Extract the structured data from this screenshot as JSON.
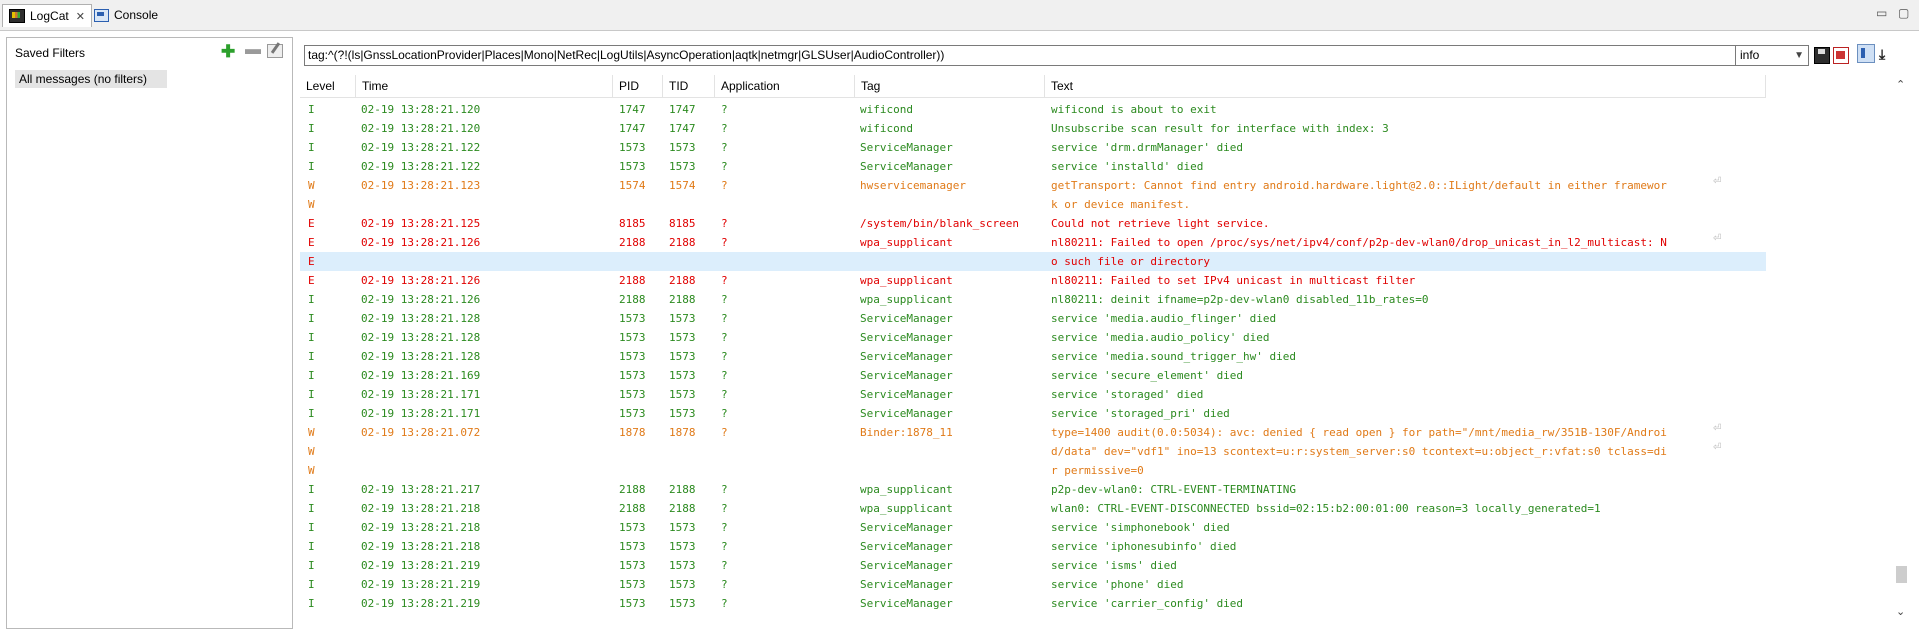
{
  "tabs": [
    {
      "label": "LogCat",
      "icon": "logcat-icon",
      "close": "✕"
    },
    {
      "label": "Console",
      "icon": "console-icon"
    }
  ],
  "window_controls": {
    "minimize": "▭",
    "maximize": "▢"
  },
  "saved_filters": {
    "title": "Saved Filters",
    "add": "✚",
    "remove": "▬",
    "items": [
      "All messages (no filters)"
    ]
  },
  "filter": {
    "query": "tag:^(?!(ls|GnssLocationProvider|Places|Mono|NetRec|LogUtils|AsyncOperation|aqtk|netmgr|GLSUser|AudioController))",
    "level": "info",
    "level_chevron": "▼",
    "download": "⤓"
  },
  "columns": [
    "Level",
    "Time",
    "PID",
    "TID",
    "Application",
    "Tag",
    "Text"
  ],
  "colors": {
    "info": "#2b8a1f",
    "warn": "#e07a18",
    "error": "#e00000",
    "selected_row": "#dceefc"
  },
  "rows": [
    {
      "level": "I",
      "time": "02-19 13:28:21.120",
      "pid": "1747",
      "tid": "1747",
      "app": "?",
      "tag": "wificond",
      "text": "wificond is about to exit"
    },
    {
      "level": "I",
      "time": "02-19 13:28:21.120",
      "pid": "1747",
      "tid": "1747",
      "app": "?",
      "tag": "wificond",
      "text": "Unsubscribe scan result for interface with index: 3"
    },
    {
      "level": "I",
      "time": "02-19 13:28:21.122",
      "pid": "1573",
      "tid": "1573",
      "app": "?",
      "tag": "ServiceManager",
      "text": "service 'drm.drmManager' died"
    },
    {
      "level": "I",
      "time": "02-19 13:28:21.122",
      "pid": "1573",
      "tid": "1573",
      "app": "?",
      "tag": "ServiceManager",
      "text": "service 'installd' died"
    },
    {
      "level": "W",
      "time": "02-19 13:28:21.123",
      "pid": "1574",
      "tid": "1574",
      "app": "?",
      "tag": "hwservicemanager",
      "text": "getTransport: Cannot find entry android.hardware.light@2.0::ILight/default in either framewor",
      "wrap": "⏎"
    },
    {
      "level": "W",
      "time": "",
      "pid": "",
      "tid": "",
      "app": "",
      "tag": "",
      "text": "k or device manifest."
    },
    {
      "level": "E",
      "time": "02-19 13:28:21.125",
      "pid": "8185",
      "tid": "8185",
      "app": "?",
      "tag": "/system/bin/blank_screen",
      "text": "Could not retrieve light service."
    },
    {
      "level": "E",
      "time": "02-19 13:28:21.126",
      "pid": "2188",
      "tid": "2188",
      "app": "?",
      "tag": "wpa_supplicant",
      "text": "nl80211: Failed to open /proc/sys/net/ipv4/conf/p2p-dev-wlan0/drop_unicast_in_l2_multicast: N",
      "wrap": "⏎"
    },
    {
      "level": "E",
      "time": "",
      "pid": "",
      "tid": "",
      "app": "",
      "tag": "",
      "text": "o such file or directory",
      "selected": true
    },
    {
      "level": "E",
      "time": "02-19 13:28:21.126",
      "pid": "2188",
      "tid": "2188",
      "app": "?",
      "tag": "wpa_supplicant",
      "text": "nl80211: Failed to set IPv4 unicast in multicast filter"
    },
    {
      "level": "I",
      "time": "02-19 13:28:21.126",
      "pid": "2188",
      "tid": "2188",
      "app": "?",
      "tag": "wpa_supplicant",
      "text": "nl80211: deinit ifname=p2p-dev-wlan0 disabled_11b_rates=0"
    },
    {
      "level": "I",
      "time": "02-19 13:28:21.128",
      "pid": "1573",
      "tid": "1573",
      "app": "?",
      "tag": "ServiceManager",
      "text": "service 'media.audio_flinger' died"
    },
    {
      "level": "I",
      "time": "02-19 13:28:21.128",
      "pid": "1573",
      "tid": "1573",
      "app": "?",
      "tag": "ServiceManager",
      "text": "service 'media.audio_policy' died"
    },
    {
      "level": "I",
      "time": "02-19 13:28:21.128",
      "pid": "1573",
      "tid": "1573",
      "app": "?",
      "tag": "ServiceManager",
      "text": "service 'media.sound_trigger_hw' died"
    },
    {
      "level": "I",
      "time": "02-19 13:28:21.169",
      "pid": "1573",
      "tid": "1573",
      "app": "?",
      "tag": "ServiceManager",
      "text": "service 'secure_element' died"
    },
    {
      "level": "I",
      "time": "02-19 13:28:21.171",
      "pid": "1573",
      "tid": "1573",
      "app": "?",
      "tag": "ServiceManager",
      "text": "service 'storaged' died"
    },
    {
      "level": "I",
      "time": "02-19 13:28:21.171",
      "pid": "1573",
      "tid": "1573",
      "app": "?",
      "tag": "ServiceManager",
      "text": "service 'storaged_pri' died"
    },
    {
      "level": "W",
      "time": "02-19 13:28:21.072",
      "pid": "1878",
      "tid": "1878",
      "app": "?",
      "tag": "Binder:1878_11",
      "text": "type=1400 audit(0.0:5034): avc: denied { read open } for path=\"/mnt/media_rw/351B-130F/Androi",
      "wrap": "⏎"
    },
    {
      "level": "W",
      "time": "",
      "pid": "",
      "tid": "",
      "app": "",
      "tag": "",
      "text": "d/data\" dev=\"vdf1\" ino=13 scontext=u:r:system_server:s0 tcontext=u:object_r:vfat:s0 tclass=di",
      "wrap": "⏎"
    },
    {
      "level": "W",
      "time": "",
      "pid": "",
      "tid": "",
      "app": "",
      "tag": "",
      "text": "r permissive=0"
    },
    {
      "level": "I",
      "time": "02-19 13:28:21.217",
      "pid": "2188",
      "tid": "2188",
      "app": "?",
      "tag": "wpa_supplicant",
      "text": "p2p-dev-wlan0: CTRL-EVENT-TERMINATING"
    },
    {
      "level": "I",
      "time": "02-19 13:28:21.218",
      "pid": "2188",
      "tid": "2188",
      "app": "?",
      "tag": "wpa_supplicant",
      "text": "wlan0: CTRL-EVENT-DISCONNECTED bssid=02:15:b2:00:01:00 reason=3 locally_generated=1"
    },
    {
      "level": "I",
      "time": "02-19 13:28:21.218",
      "pid": "1573",
      "tid": "1573",
      "app": "?",
      "tag": "ServiceManager",
      "text": "service 'simphonebook' died"
    },
    {
      "level": "I",
      "time": "02-19 13:28:21.218",
      "pid": "1573",
      "tid": "1573",
      "app": "?",
      "tag": "ServiceManager",
      "text": "service 'iphonesubinfo' died"
    },
    {
      "level": "I",
      "time": "02-19 13:28:21.219",
      "pid": "1573",
      "tid": "1573",
      "app": "?",
      "tag": "ServiceManager",
      "text": "service 'isms' died"
    },
    {
      "level": "I",
      "time": "02-19 13:28:21.219",
      "pid": "1573",
      "tid": "1573",
      "app": "?",
      "tag": "ServiceManager",
      "text": "service 'phone' died"
    },
    {
      "level": "I",
      "time": "02-19 13:28:21.219",
      "pid": "1573",
      "tid": "1573",
      "app": "?",
      "tag": "ServiceManager",
      "text": "service 'carrier_config' died"
    }
  ],
  "scrollbar": {
    "up": "⌃",
    "down": "⌄"
  }
}
